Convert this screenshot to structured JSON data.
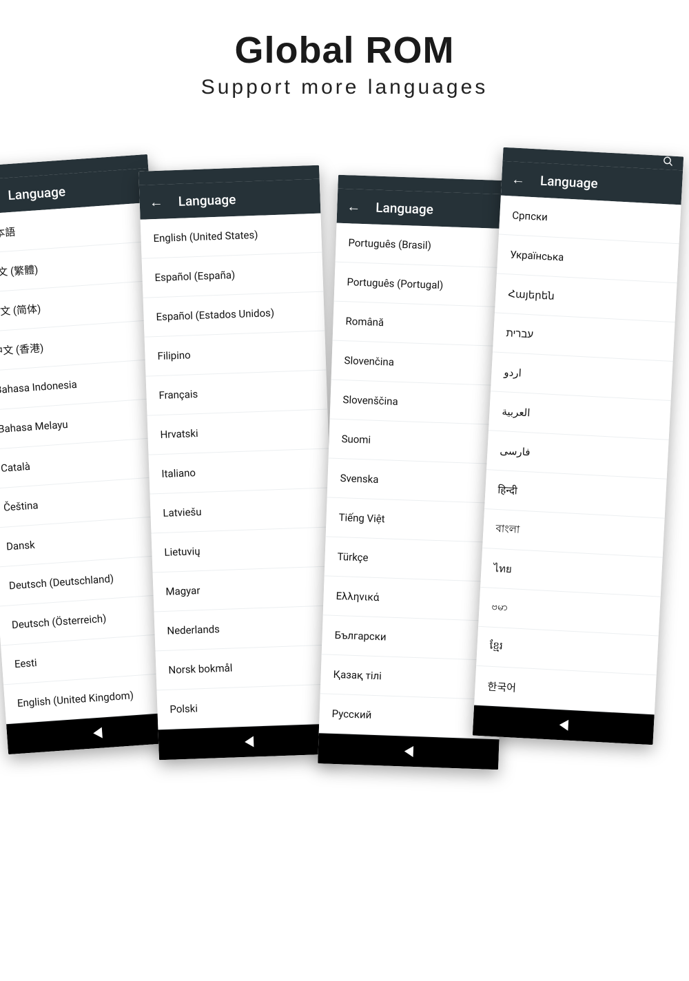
{
  "headline": "Global ROM",
  "subhead": "Support more languages",
  "appbar_title": "Language",
  "phones": {
    "p1": {
      "items": [
        "日本語",
        "中文 (繁體)",
        "中文 (简体)",
        "中文 (香港)",
        "Bahasa Indonesia",
        "Bahasa Melayu",
        "Català",
        "Čeština",
        "Dansk",
        "Deutsch (Deutschland)",
        "Deutsch (Österreich)",
        "Eesti",
        "English (United Kingdom)"
      ]
    },
    "p2": {
      "items": [
        "English (United States)",
        "Español (España)",
        "Español (Estados Unidos)",
        "Filipino",
        "Français",
        "Hrvatski",
        "Italiano",
        "Latviešu",
        "Lietuvių",
        "Magyar",
        "Nederlands",
        "Norsk bokmål",
        "Polski"
      ]
    },
    "p3": {
      "items": [
        "Português (Brasil)",
        "Português (Portugal)",
        "Română",
        "Slovenčina",
        "Slovenščina",
        "Suomi",
        "Svenska",
        "Tiếng Việt",
        "Türkçe",
        "Ελληνικά",
        "Български",
        "Қазақ тілі",
        "Русский"
      ]
    },
    "p4": {
      "items": [
        "Српски",
        "Українська",
        "Հայերեն",
        "עברית",
        "اردو",
        "العربية",
        "فارسی",
        "हिन्दी",
        "বাংলা",
        "ไทย",
        "ဗမာ",
        "ខ្មែរ",
        "한국어"
      ]
    }
  }
}
